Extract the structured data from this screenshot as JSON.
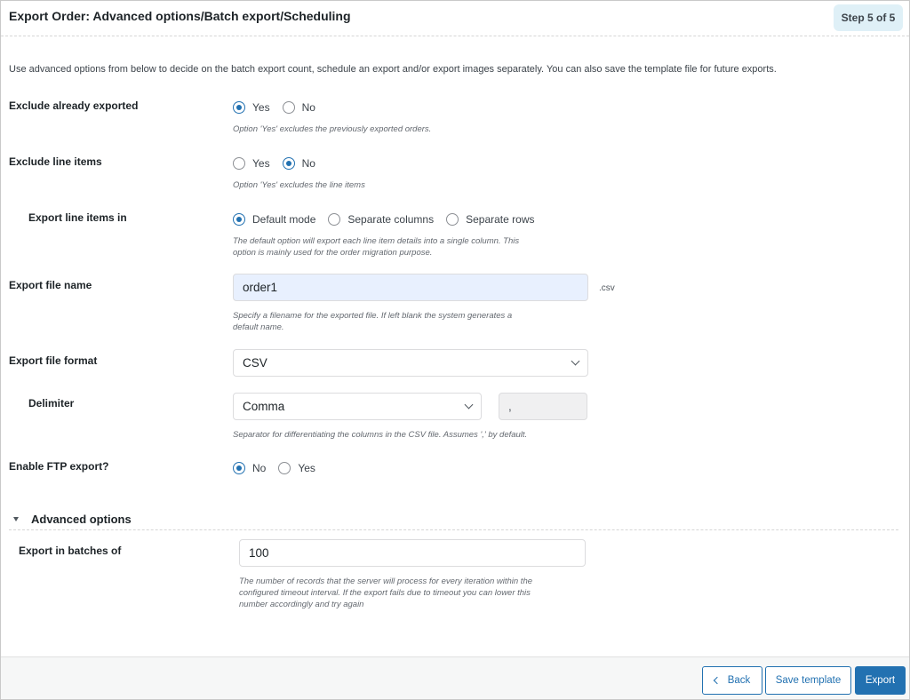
{
  "header": {
    "title": "Export Order: Advanced options/Batch export/Scheduling",
    "step_badge": "Step 5 of 5"
  },
  "intro": "Use advanced options from below to decide on the batch export count, schedule an export and/or export images separately. You can also save the template file for future exports.",
  "fields": {
    "exclude_exported": {
      "label": "Exclude already exported",
      "options": [
        {
          "label": "Yes",
          "checked": true
        },
        {
          "label": "No",
          "checked": false
        }
      ],
      "help": "Option 'Yes' excludes the previously exported orders."
    },
    "exclude_line_items": {
      "label": "Exclude line items",
      "options": [
        {
          "label": "Yes",
          "checked": false
        },
        {
          "label": "No",
          "checked": true
        }
      ],
      "help": "Option 'Yes' excludes the line items"
    },
    "export_line_items_in": {
      "label": "Export line items in",
      "options": [
        {
          "label": "Default mode",
          "checked": true
        },
        {
          "label": "Separate columns",
          "checked": false
        },
        {
          "label": "Separate rows",
          "checked": false
        }
      ],
      "help_line1": "The default option will export each line item details into a single column. This",
      "help_line2": "option is mainly used for the order migration purpose."
    },
    "file_name": {
      "label": "Export file name",
      "value": "order1",
      "extension": ".csv",
      "help_line1": "Specify a filename for the exported file. If left blank the system generates a",
      "help_line2": "default name."
    },
    "file_format": {
      "label": "Export file format",
      "selected": "CSV"
    },
    "delimiter": {
      "label": "Delimiter",
      "selected": "Comma",
      "char_value": ",",
      "help": "Separator for differentiating the columns in the CSV file. Assumes ',' by default."
    },
    "ftp_export": {
      "label": "Enable FTP export?",
      "options": [
        {
          "label": "No",
          "checked": true
        },
        {
          "label": "Yes",
          "checked": false
        }
      ]
    }
  },
  "advanced": {
    "title": "Advanced options",
    "batch": {
      "label": "Export in batches of",
      "value": "100",
      "help_line1": "The number of records that the server will process for every iteration within the",
      "help_line2": "configured timeout interval. If the export fails due to timeout you can lower this",
      "help_line3": "number accordingly and try again"
    }
  },
  "footer": {
    "back_label": "Back",
    "save_template_label": "Save template",
    "export_label": "Export"
  },
  "colors": {
    "accent": "#2271b1",
    "badge_bg": "#dff0f7",
    "autofill_bg": "#e8f0fe"
  }
}
